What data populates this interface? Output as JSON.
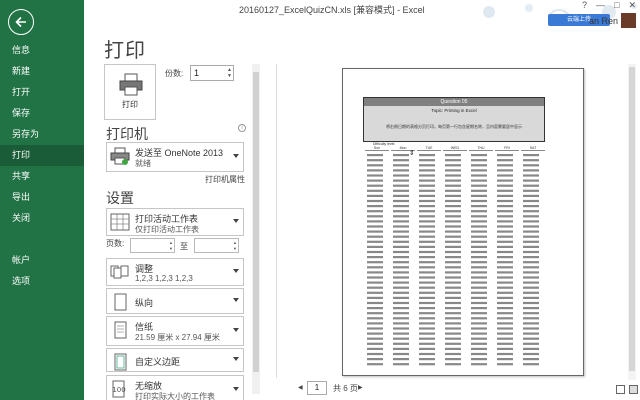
{
  "window": {
    "title": "20160127_ExcelQuizCN.xls  [兼容模式] - Excel",
    "user_name": "an Ren",
    "upload_label": "云端上传",
    "controls": [
      "?",
      "—",
      "□",
      "✕"
    ]
  },
  "nav": {
    "items": [
      {
        "label": "信息",
        "active": false
      },
      {
        "label": "新建",
        "active": false
      },
      {
        "label": "打开",
        "active": false
      },
      {
        "label": "保存",
        "active": false
      },
      {
        "label": "另存为",
        "active": false
      },
      {
        "label": "打印",
        "active": true
      },
      {
        "label": "共享",
        "active": false
      },
      {
        "label": "导出",
        "active": false
      },
      {
        "label": "关闭",
        "active": false
      },
      {
        "label": "",
        "active": false
      },
      {
        "label": "帐户",
        "active": false
      },
      {
        "label": "选项",
        "active": false
      }
    ],
    "accent": "#217346"
  },
  "print": {
    "heading": "打印",
    "button_label": "打印",
    "copies_label": "份数:",
    "copies_value": "1"
  },
  "printer": {
    "heading": "打印机",
    "info_glyph": "i",
    "name": "发送至 OneNote 2013",
    "status": "就绪",
    "properties_link": "打印机属性"
  },
  "settings": {
    "heading": "设置",
    "what": {
      "t1": "打印活动工作表",
      "t2": "仅打印活动工作表"
    },
    "pages_label": "页数:",
    "pages_to": "至",
    "collate": {
      "t1": "调整",
      "t2": "1,2,3    1,2,3    1,2,3"
    },
    "orientation": {
      "t1": "纵向"
    },
    "paper": {
      "t1": "信纸",
      "t2": "21.59 厘米 x 27.94 厘米"
    },
    "margins": {
      "t1": "自定义边距"
    },
    "scaling": {
      "t1": "无缩放",
      "t2": "打印实际大小的工作表"
    }
  },
  "preview": {
    "page_current": "1",
    "page_total": "共 6 页",
    "question_title": "Question 05",
    "question_subtitle": "Topic: Printing in Excel",
    "question_desc": "将右侧日期的表格分页打印。每页第一行包含星期名称，且内容需要居中显示",
    "difficulty": "Difficulty level:",
    "headers": [
      "Sun",
      "Mon",
      "TUE",
      "WED",
      "THU",
      "FRI",
      "SAT"
    ]
  }
}
